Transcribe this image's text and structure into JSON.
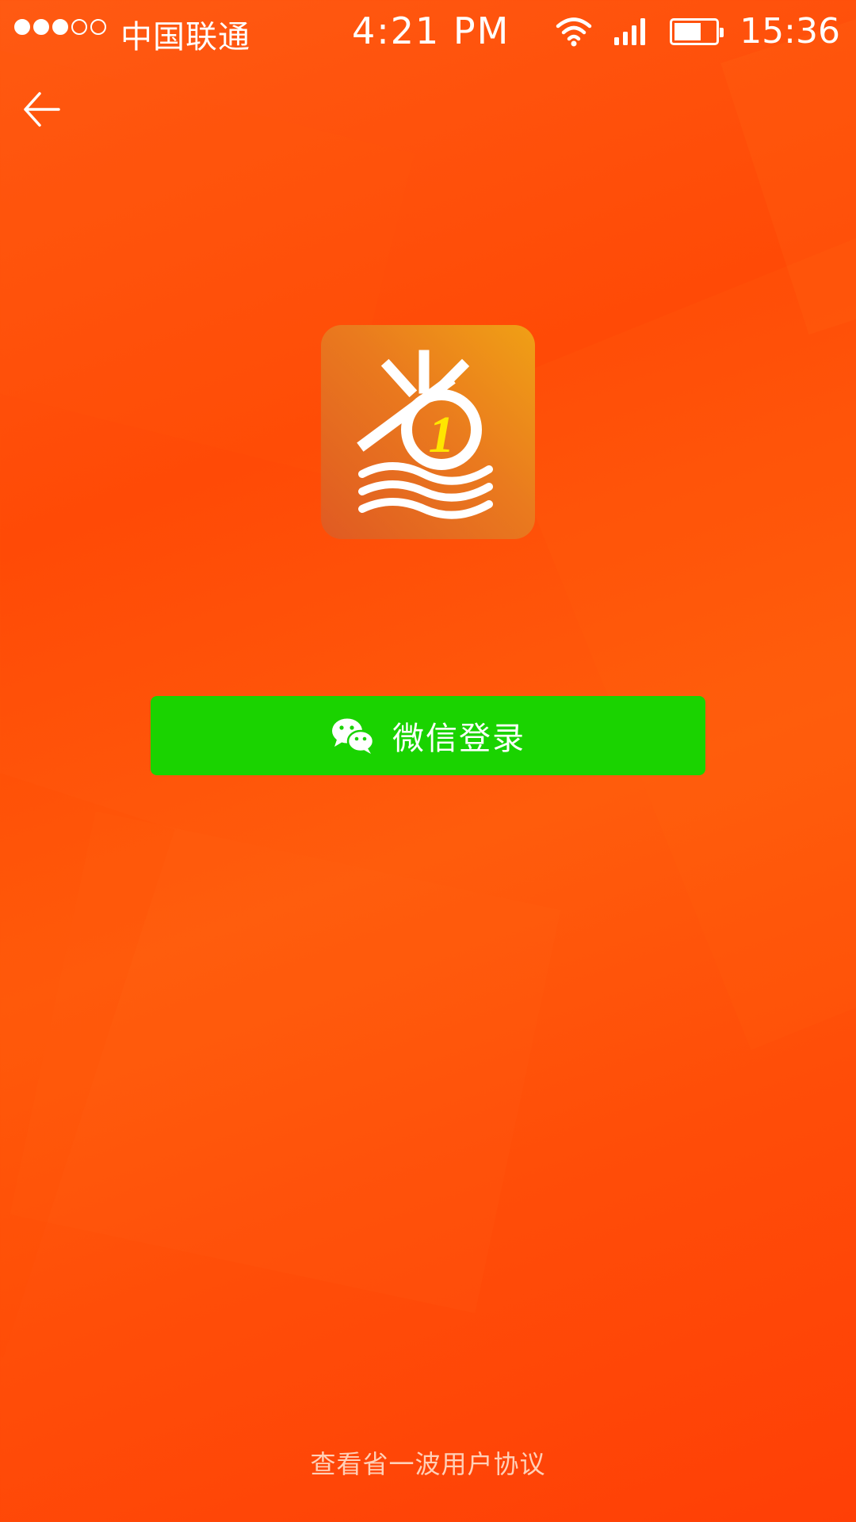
{
  "status_bar": {
    "signal_strength_filled": 3,
    "signal_strength_total": 5,
    "carrier": "中国联通",
    "center_time": "4:21 PM",
    "right_time": "15:36",
    "battery_level": 0.65,
    "icons": [
      "wifi-icon",
      "cellular-signal-icon",
      "battery-icon"
    ]
  },
  "nav": {
    "back_icon": "arrow-left-icon"
  },
  "logo": {
    "icon": "app-logo",
    "badge_text": "1"
  },
  "login": {
    "wechat_label": "微信登录",
    "wechat_icon": "wechat-icon"
  },
  "footer": {
    "agreement_text": "查看省一波用户协议"
  },
  "colors": {
    "background": "#ff4e08",
    "wechat_green": "#1ad300",
    "logo_gold": "#f0a015",
    "logo_badge_yellow": "#ffe600"
  }
}
